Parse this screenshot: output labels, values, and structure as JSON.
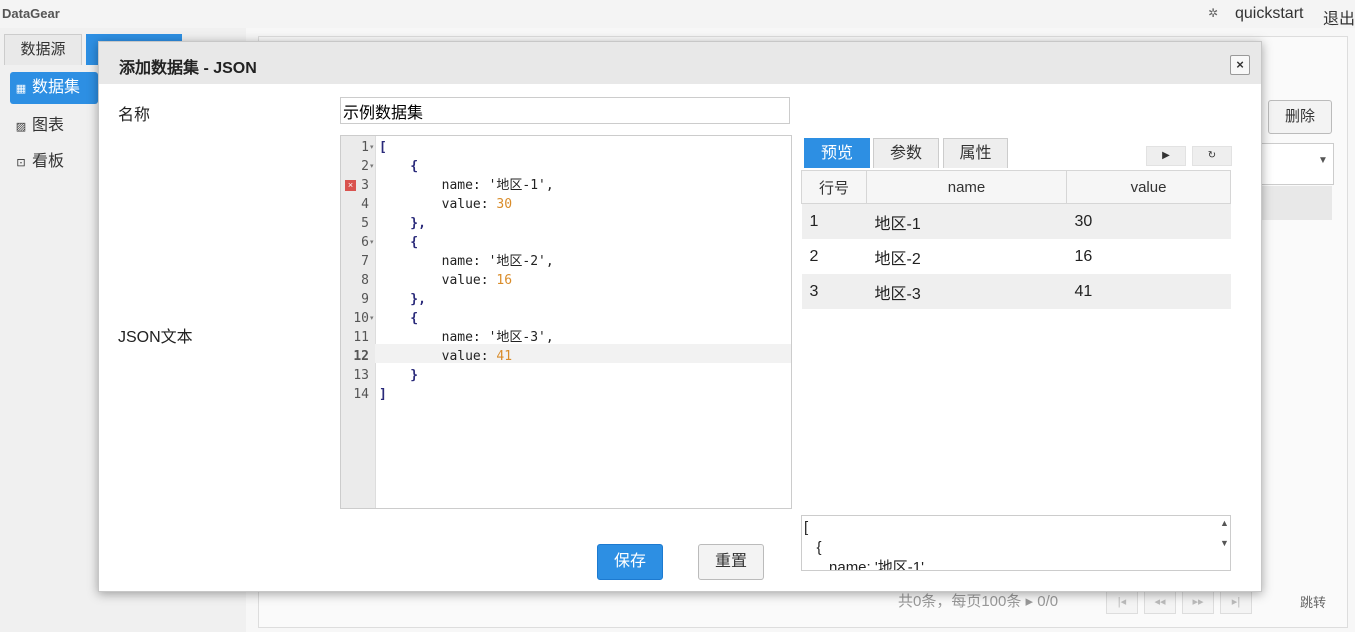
{
  "app": {
    "brand": "DataGear",
    "user": "quickstart",
    "logout": "退出",
    "settings_icon": "gear-icon"
  },
  "left_tabs": [
    "数据源",
    ""
  ],
  "nav": [
    {
      "label": "数据集",
      "icon": "grid-icon",
      "active": true
    },
    {
      "label": "图表",
      "icon": "image-icon"
    },
    {
      "label": "看板",
      "icon": "board-icon"
    }
  ],
  "background": {
    "delete_label": "删除",
    "pager_text": "共0条，每页100条 ▸ 0/0",
    "jump_label": "跳转"
  },
  "dialog": {
    "title": "添加数据集 - JSON",
    "close_glyph": "×",
    "name_label": "名称",
    "name_value": "示例数据集",
    "json_label": "JSON文本",
    "save_label": "保存",
    "reset_label": "重置"
  },
  "editor": {
    "line_numbers": [
      "1",
      "2",
      "3",
      "4",
      "5",
      "6",
      "7",
      "8",
      "9",
      "10",
      "11",
      "12",
      "13",
      "14"
    ],
    "error_line": 3,
    "active_line": 12,
    "lines": [
      "[",
      "    {",
      "        name: '地区-1',",
      "        value: 30",
      "    },",
      "    {",
      "        name: '地区-2',",
      "        value: 16",
      "    },",
      "    {",
      "        name: '地区-3',",
      "        value: 41",
      "    }",
      "]"
    ]
  },
  "preview": {
    "tabs": [
      "预览",
      "参数",
      "属性"
    ],
    "run_icon": "play-icon",
    "refresh_icon": "refresh-icon",
    "columns": [
      "行号",
      "name",
      "value"
    ],
    "rows": [
      [
        "1",
        "地区-1",
        "30"
      ],
      [
        "2",
        "地区-2",
        "16"
      ],
      [
        "3",
        "地区-3",
        "41"
      ]
    ],
    "result_text": "[\n   {\n      name: '地区-1'"
  },
  "colors": {
    "accent": "#2d8fe3"
  }
}
